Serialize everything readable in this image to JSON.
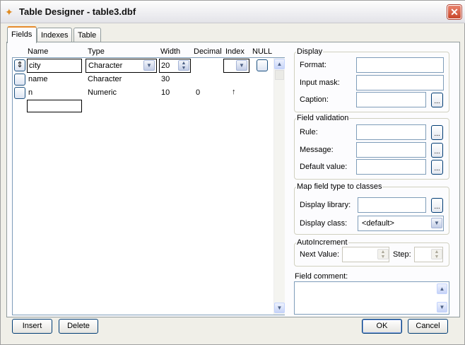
{
  "window": {
    "title": "Table Designer - table3.dbf",
    "close_label": "✕"
  },
  "tabs": [
    "Fields",
    "Indexes",
    "Table"
  ],
  "grid": {
    "headers": [
      "Name",
      "Type",
      "Width",
      "Decimal",
      "Index",
      "NULL"
    ],
    "rows": [
      {
        "name": "city",
        "type": "Character",
        "width": "20",
        "decimal": "",
        "index": ""
      },
      {
        "name": "name",
        "type": "Character",
        "width": "30",
        "decimal": "",
        "index": ""
      },
      {
        "name": "n",
        "type": "Numeric",
        "width": "10",
        "decimal": "0",
        "index": "↑"
      }
    ]
  },
  "display": {
    "title": "Display",
    "format": "Format:",
    "input_mask": "Input mask:",
    "caption": "Caption:"
  },
  "validation": {
    "title": "Field validation",
    "rule": "Rule:",
    "message": "Message:",
    "default_value": "Default value:"
  },
  "mapping": {
    "title": "Map field type to classes",
    "library": "Display library:",
    "class": "Display class:",
    "class_value": "<default>"
  },
  "autoinc": {
    "title": "AutoIncrement",
    "next": "Next Value:",
    "step": "Step:"
  },
  "comment": {
    "label": "Field comment:"
  },
  "buttons": {
    "insert": "Insert",
    "delete": "Delete",
    "ok": "OK",
    "cancel": "Cancel",
    "ellipsis": "..."
  }
}
